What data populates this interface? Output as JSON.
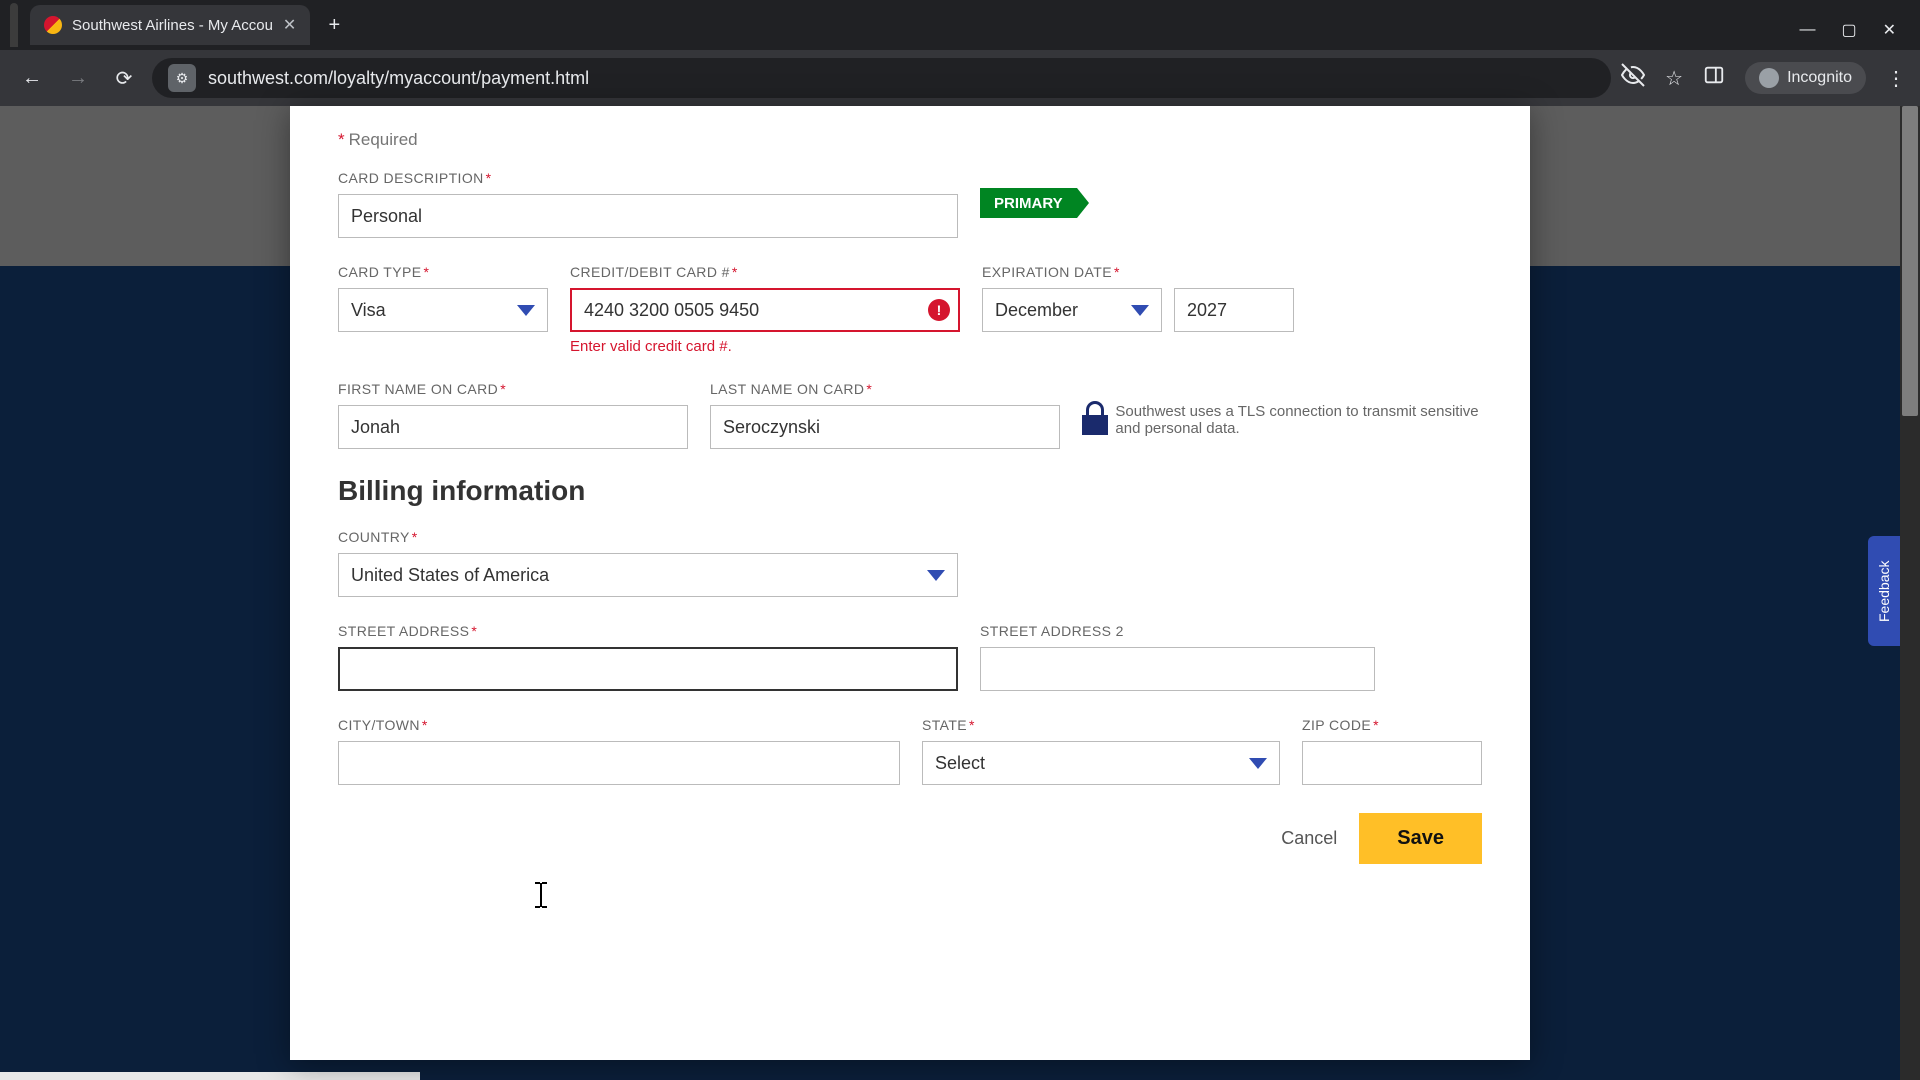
{
  "browser": {
    "tab_title": "Southwest Airlines - My Accou",
    "url": "southwest.com/loyalty/myaccount/payment.html",
    "incognito_label": "Incognito"
  },
  "feedback": {
    "label": "Feedback"
  },
  "modal": {
    "required_hint": "Required",
    "primary_badge": "PRIMARY",
    "card_description": {
      "label": "CARD DESCRIPTION",
      "value": "Personal"
    },
    "card_type": {
      "label": "CARD TYPE",
      "value": "Visa"
    },
    "card_number": {
      "label": "CREDIT/DEBIT CARD #",
      "value": "4240 3200 0505 9450",
      "error": "Enter valid credit card #."
    },
    "expiration": {
      "label": "EXPIRATION DATE",
      "month": "December",
      "year": "2027"
    },
    "first_name": {
      "label": "FIRST NAME ON CARD",
      "value": "Jonah"
    },
    "last_name": {
      "label": "LAST NAME ON CARD",
      "value": "Seroczynski"
    },
    "tls_note": "Southwest uses a TLS connection to transmit sensitive and personal data.",
    "billing_heading": "Billing information",
    "country": {
      "label": "COUNTRY",
      "value": "United States of America"
    },
    "street1": {
      "label": "STREET ADDRESS",
      "value": ""
    },
    "street2": {
      "label": "STREET ADDRESS 2",
      "value": ""
    },
    "city": {
      "label": "CITY/TOWN",
      "value": ""
    },
    "state": {
      "label": "STATE",
      "value": "Select"
    },
    "zip": {
      "label": "ZIP CODE",
      "value": ""
    },
    "cancel": "Cancel",
    "save": "Save"
  }
}
